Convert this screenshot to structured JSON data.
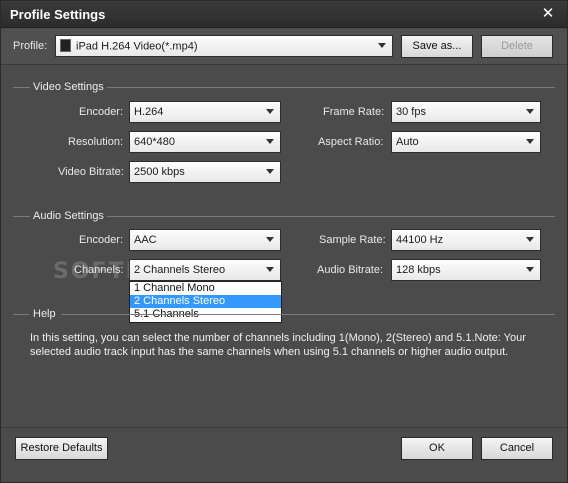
{
  "window": {
    "title": "Profile Settings"
  },
  "profile": {
    "label": "Profile:",
    "value": "iPad H.264 Video(*.mp4)",
    "save_label": "Save as...",
    "delete_label": "Delete"
  },
  "video": {
    "title": "Video Settings",
    "encoder_label": "Encoder:",
    "encoder_value": "H.264",
    "resolution_label": "Resolution:",
    "resolution_value": "640*480",
    "bitrate_label": "Video Bitrate:",
    "bitrate_value": "2500 kbps",
    "framerate_label": "Frame Rate:",
    "framerate_value": "30 fps",
    "aspect_label": "Aspect Ratio:",
    "aspect_value": "Auto"
  },
  "audio": {
    "title": "Audio Settings",
    "encoder_label": "Encoder:",
    "encoder_value": "AAC",
    "channels_label": "Channels:",
    "channels_value": "2 Channels Stereo",
    "channels_options": [
      "1 Channel Mono",
      "2 Channels Stereo",
      "5.1 Channels"
    ],
    "samplerate_label": "Sample Rate:",
    "samplerate_value": "44100 Hz",
    "bitrate_label": "Audio Bitrate:",
    "bitrate_value": "128 kbps"
  },
  "help": {
    "title": "Help",
    "text": "In this setting, you can select the number of channels including 1(Mono), 2(Stereo) and 5.1.Note: Your selected audio track input has the same channels when using 5.1 channels or higher audio output."
  },
  "footer": {
    "restore_label": "Restore Defaults",
    "ok_label": "OK",
    "cancel_label": "Cancel"
  },
  "watermark": "SOFTPEDIA",
  "colors": {
    "selection": "#3399ff",
    "background": "#4b4b4b"
  },
  "icons": {
    "close": "close-icon",
    "dropdown": "chevron-down-icon",
    "device": "ipad-icon"
  }
}
